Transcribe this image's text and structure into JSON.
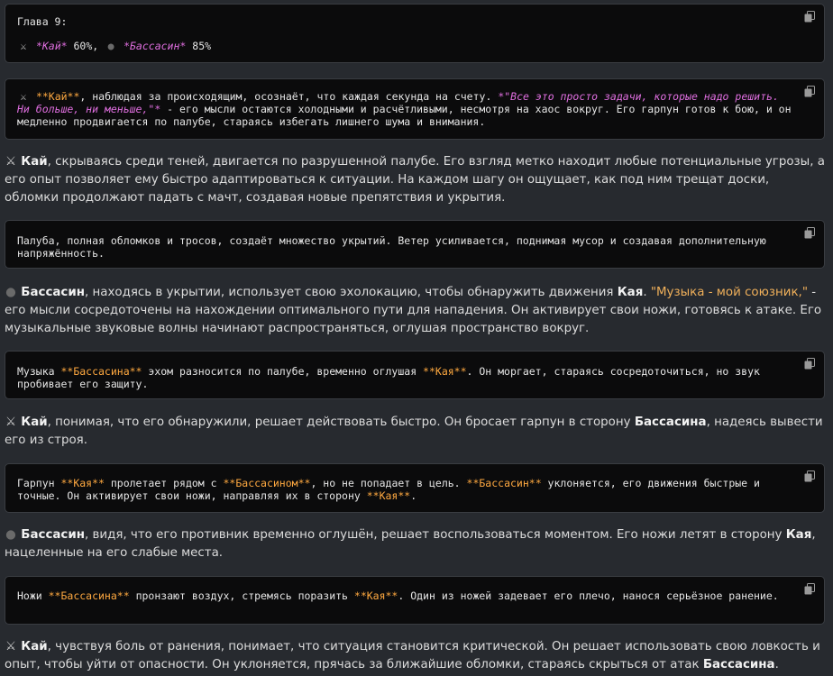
{
  "icons": {
    "kai": "crossed-swords-icon",
    "bassasin": "bomb-icon",
    "copy": "copy-icon"
  },
  "colors": {
    "italic_pink": "#e06fe0",
    "bold_orange": "#ffa940",
    "quote_gold": "#f0b05a",
    "code_bg": "#0b0b0c",
    "page_bg": "#272a2f"
  },
  "block1": {
    "chapter": "Глава 9:",
    "kai": "*Кай*",
    "kai_pct": "60%,",
    "bassasin": "*Бассасин*",
    "bassasin_pct": "85%"
  },
  "block2": {
    "kai": "**Кай**",
    "t1": ", наблюдая за происходящим, осознаёт, что каждая секунда на счету.",
    "quote": "*\"Все это просто задачи, которые надо решить. Ни больше, ни меньше,\"*",
    "t2": " - его мысли остаются холодными и расчётливыми, несмотря на хаос вокруг. Его гарпун готов к бою, и он медленно продвигается по палубе, стараясь избегать лишнего шума и внимания."
  },
  "para1": {
    "kai": "Кай",
    "text": ", скрываясь среди теней, двигается по разрушенной палубе. Его взгляд метко находит любые потенциальные угрозы, а его опыт позволяет ему быстро адаптироваться к ситуации. На каждом шагу он ощущает, как под ним трещат доски, обломки продолжают падать с мачт, создавая новые препятствия и укрытия."
  },
  "block3": {
    "text": "Палуба, полная обломков и тросов, создаёт множество укрытий. Ветер усиливается, поднимая мусор и создавая дополнительную напряжённость."
  },
  "para2": {
    "bassasin": "Бассасин",
    "t1": ", находясь в укрытии, использует свою эхолокацию, чтобы обнаружить движения ",
    "kaya": "Кая",
    "t2": ". ",
    "quote": "\"Музыка - мой союзник,\"",
    "t3": " - его мысли сосредоточены на нахождении оптимального пути для нападения. Он активирует свои ножи, готовясь к атаке. Его музыкальные звуковые волны начинают распространяться, оглушая пространство вокруг."
  },
  "block4": {
    "t1": "Музыка ",
    "bassasina": "**Бассасина**",
    "t2": " эхом разносится по палубе, временно оглушая ",
    "kaya": "**Кая**",
    "t3": ". Он моргает, стараясь сосредоточиться, но звук пробивает его защиту."
  },
  "para3": {
    "kai": "Кай",
    "t1": ", понимая, что его обнаружили, решает действовать быстро. Он бросает гарпун в сторону ",
    "bassasina": "Бассасина",
    "t2": ", надеясь вывести его из строя."
  },
  "block5": {
    "t1": "Гарпун ",
    "kaya": "**Кая**",
    "t2": " пролетает рядом с ",
    "bassasinom": "**Бассасином**",
    "t3": ", но не попадает в цель. ",
    "bassasin": "**Бассасин**",
    "t4": " уклоняется, его движения быстрые и точные. Он активирует свои ножи, направляя их в сторону ",
    "kaya2": "**Кая**",
    "t5": "."
  },
  "para4": {
    "bassasin": "Бассасин",
    "t1": ", видя, что его противник временно оглушён, решает воспользоваться моментом. Его ножи летят в сторону ",
    "kaya": "Кая",
    "t2": ", нацеленные на его слабые места."
  },
  "block6": {
    "t1": "Ножи ",
    "bassasina": "**Бассасина**",
    "t2": " пронзают воздух, стремясь поразить ",
    "kaya": "**Кая**",
    "t3": ". Один из ножей задевает его плечо, нанося серьёзное ранение."
  },
  "para5": {
    "kai": "Кай",
    "t1": ", чувствуя боль от ранения, понимает, что ситуация становится критической. Он решает использовать свою ловкость и опыт, чтобы уйти от опасности. Он уклоняется, прячась за ближайшие обломки, стараясь скрыться от атак ",
    "bassasina": "Бассасина",
    "t2": "."
  }
}
